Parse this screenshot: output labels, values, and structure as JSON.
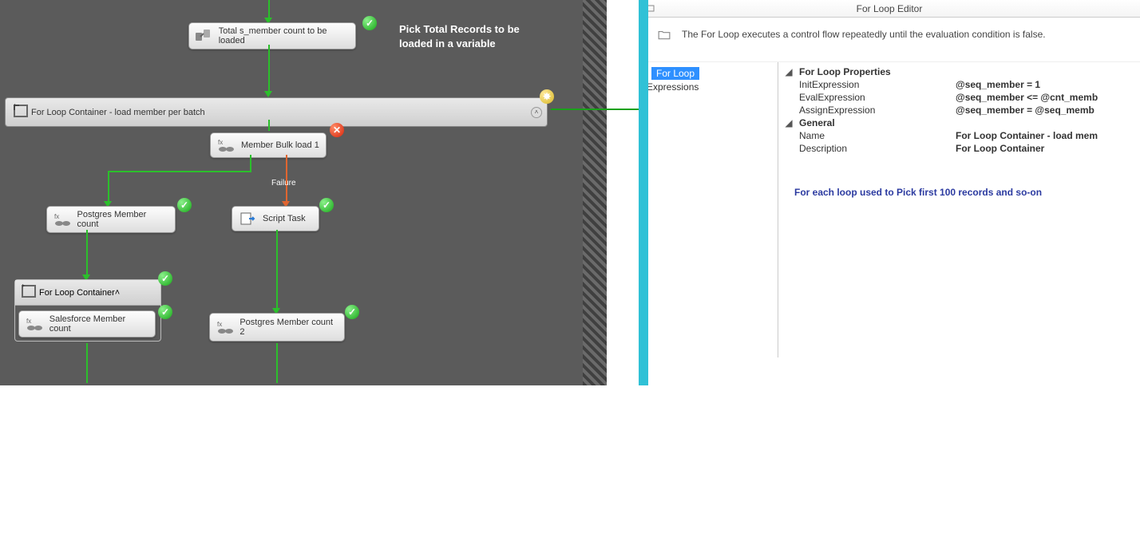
{
  "annotation": "Pick Total Records to be loaded in a variable",
  "failure_label": "Failure",
  "tasks": {
    "total_count": "Total s_member count to be loaded",
    "for_loop_outer": "For Loop Container - load member per batch",
    "bulk_load": "Member Bulk load 1",
    "pg_count": "Postgres Member count",
    "script": "Script Task",
    "for_loop_inner": "For Loop Container",
    "sf_count": "Salesforce Member count",
    "pg_count2": "Postgres Member count 2"
  },
  "editor": {
    "title": "For Loop Editor",
    "description": "The For Loop executes a control flow repeatedly until the evaluation condition is false.",
    "tree": {
      "for_loop": "For Loop",
      "expressions": "Expressions"
    },
    "sections": {
      "props_header": "For Loop Properties",
      "general_header": "General"
    },
    "props": {
      "init_k": "InitExpression",
      "init_v": "@seq_member = 1",
      "eval_k": "EvalExpression",
      "eval_v": "@seq_member <= @cnt_memb",
      "assign_k": "AssignExpression",
      "assign_v": "@seq_member =  @seq_memb",
      "name_k": "Name",
      "name_v": "For Loop Container - load mem",
      "desc_k": "Description",
      "desc_v": "For Loop Container"
    },
    "note": "For each loop used to Pick first 100 records and so-on"
  }
}
